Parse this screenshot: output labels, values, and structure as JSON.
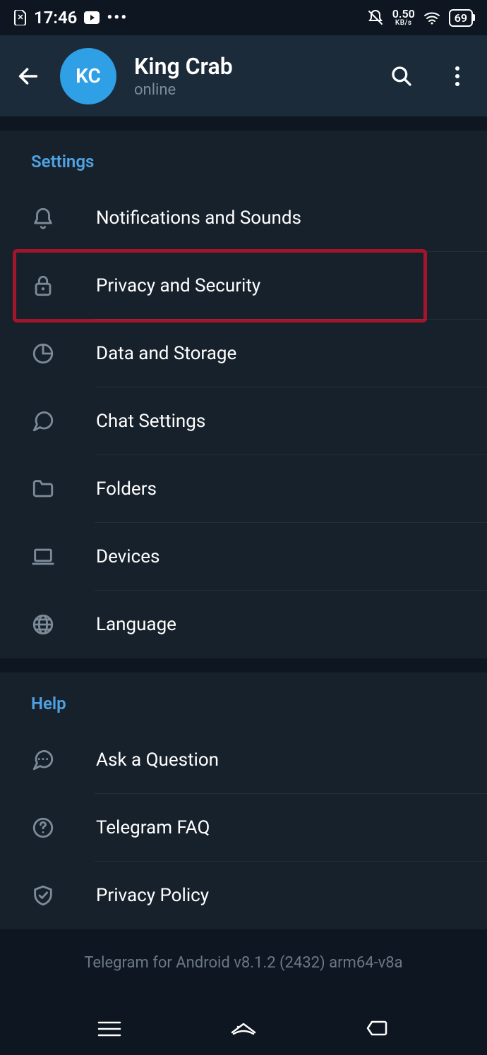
{
  "status": {
    "time": "17:46",
    "net_speed": "0.50",
    "net_unit": "KB/s",
    "battery": "69"
  },
  "header": {
    "avatar_initials": "KC",
    "name": "King Crab",
    "status": "online"
  },
  "settings": {
    "title": "Settings",
    "items": [
      {
        "label": "Notifications and Sounds"
      },
      {
        "label": "Privacy and Security"
      },
      {
        "label": "Data and Storage"
      },
      {
        "label": "Chat Settings"
      },
      {
        "label": "Folders"
      },
      {
        "label": "Devices"
      },
      {
        "label": "Language"
      }
    ]
  },
  "help": {
    "title": "Help",
    "items": [
      {
        "label": "Ask a Question"
      },
      {
        "label": "Telegram FAQ"
      },
      {
        "label": "Privacy Policy"
      }
    ]
  },
  "version": "Telegram for Android v8.1.2 (2432) arm64-v8a"
}
